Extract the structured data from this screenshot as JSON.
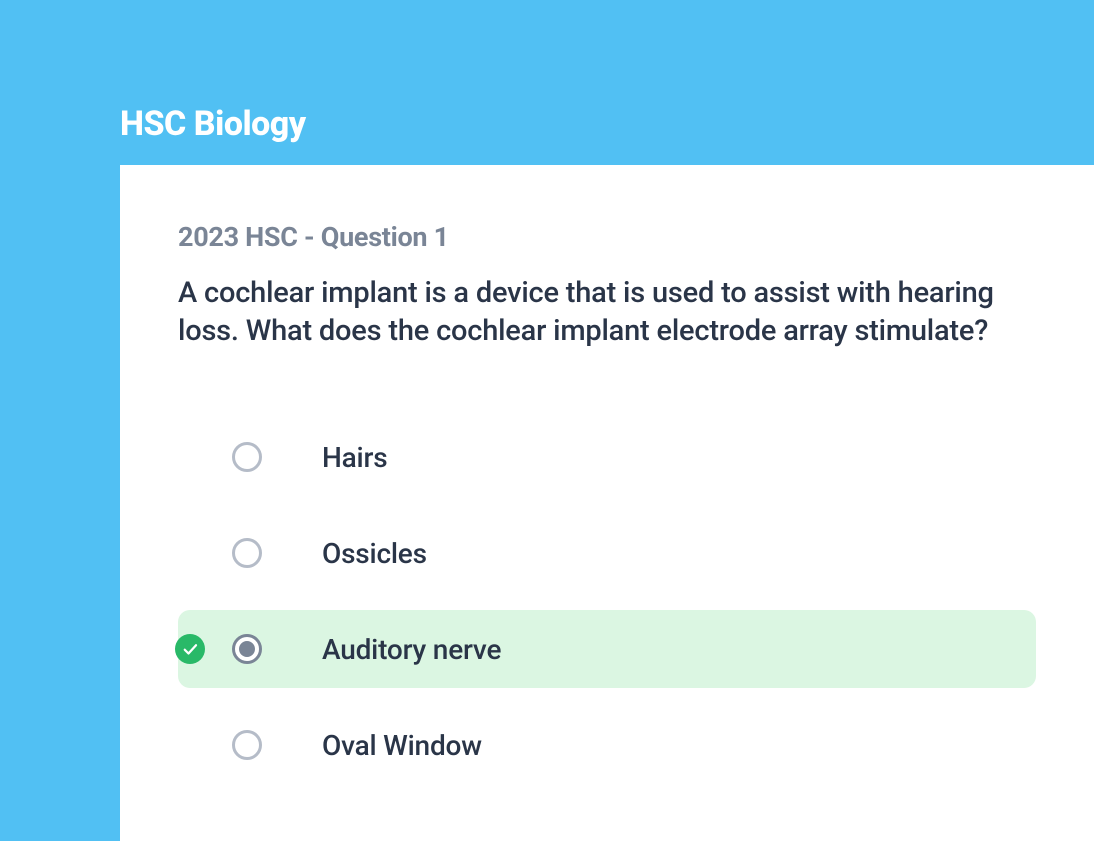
{
  "header": {
    "title": "HSC Biology"
  },
  "question": {
    "label": "2023 HSC - Question 1",
    "text": "A cochlear implant is a device that is used to assist with hearing loss. What does the cochlear implant electrode array stimulate?",
    "options": [
      {
        "label": "Hairs",
        "selected": false,
        "correct": false
      },
      {
        "label": "Ossicles",
        "selected": false,
        "correct": false
      },
      {
        "label": "Auditory nerve",
        "selected": true,
        "correct": true
      },
      {
        "label": "Oval Window",
        "selected": false,
        "correct": false
      }
    ]
  }
}
